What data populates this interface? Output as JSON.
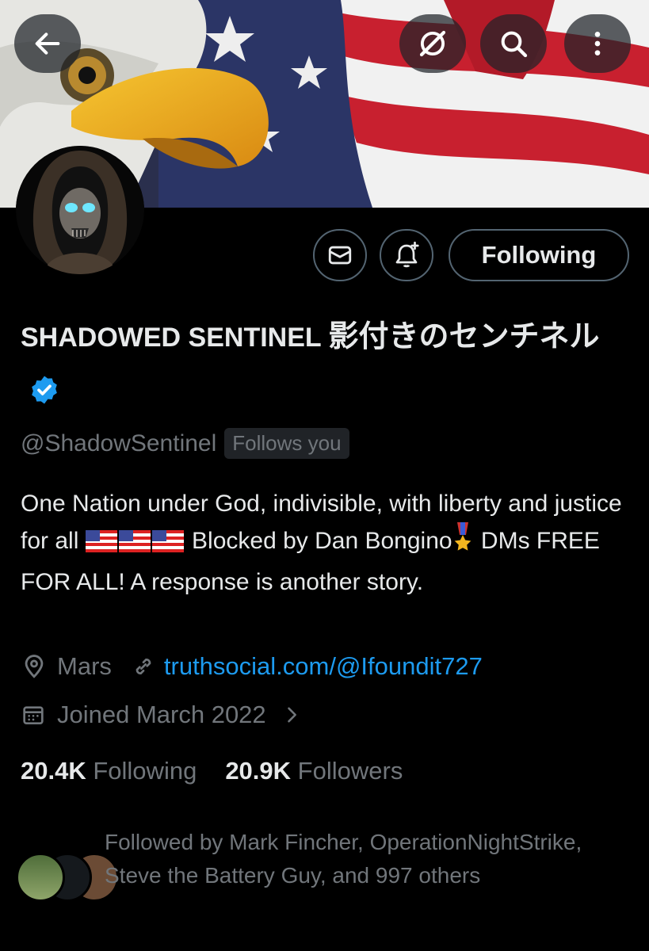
{
  "header": {
    "back_icon": "arrow-left-icon",
    "grok_icon": "grok-slash-icon",
    "search_icon": "search-icon",
    "more_icon": "more-vertical-icon"
  },
  "actions": {
    "message_icon": "mail-icon",
    "notify_icon": "bell-plus-icon",
    "following_label": "Following"
  },
  "profile": {
    "name_en": "SHADOWED SENTINEL",
    "name_jp": "影付きのセンチネル",
    "handle": "@ShadowSentinel",
    "follows_you": "Follows you",
    "bio_part1": "One Nation under God, indivisible, with liberty and justice for all ",
    "bio_part2": " Blocked by Dan Bongino",
    "bio_part3": " DMs FREE FOR ALL! A response is another story.",
    "location": "Mars",
    "website": "truthsocial.com/@Ifoundit727",
    "joined": "Joined March 2022",
    "following_count": "20.4K",
    "following_label": "Following",
    "followers_count": "20.9K",
    "followers_label": "Followers",
    "followed_by": "Followed by Mark Fincher, OperationNightStrike, Steve the Battery Guy, and 997 others"
  },
  "colors": {
    "accent": "#1d9bf0",
    "muted": "#71767b",
    "text": "#e7e9ea",
    "background": "#000000"
  }
}
